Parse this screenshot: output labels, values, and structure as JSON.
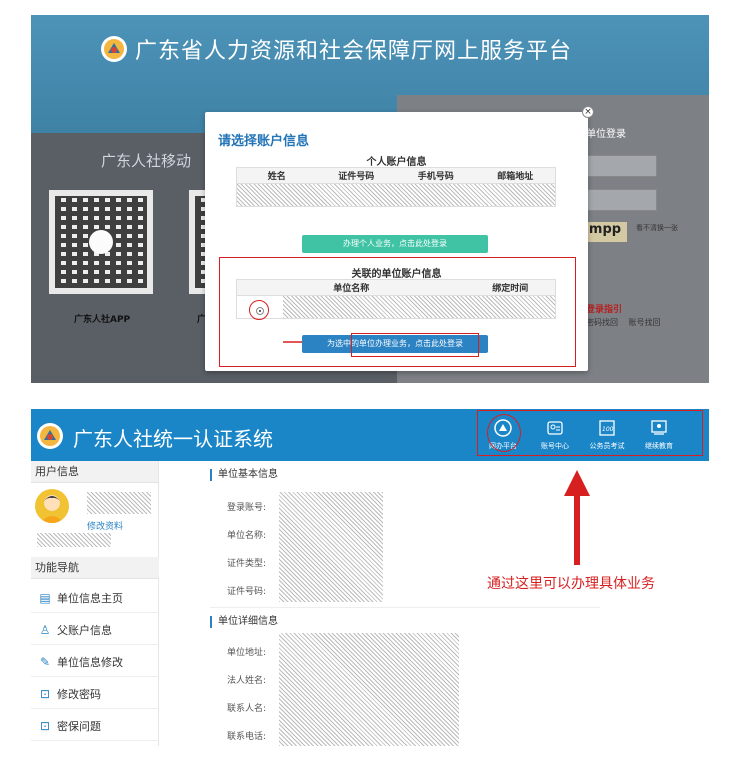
{
  "top": {
    "portal_title": "广东省人力资源和社会保障厅网上服务平台",
    "mobile_label": "广东人社移动",
    "qr1_caption": "广东人社APP",
    "qr2_caption": "广",
    "login_tab": "单位登录",
    "captcha_text": "mpp",
    "captcha_hint": "看不清换一张",
    "login_guide": "登录指引",
    "login_links": "密码找回 账号找回"
  },
  "modal": {
    "close_glyph": "×",
    "title": "请选择账户信息",
    "personal_section": "个人账户信息",
    "personal_columns": [
      "姓名",
      "证件号码",
      "手机号码",
      "邮箱地址"
    ],
    "personal_button": "办理个人业务，点击此处登录",
    "unit_section": "关联的单位账户信息",
    "unit_columns": [
      "单位名称",
      "绑定时间"
    ],
    "unit_button": "为选中的单位办理业务，点击此处登录"
  },
  "portal": {
    "title": "广东人社统一认证系统",
    "nav": [
      {
        "label": "网办平台",
        "icon": "emblem-icon"
      },
      {
        "label": "账号中心",
        "icon": "id-card-icon"
      },
      {
        "label": "公务员考试",
        "icon": "exam-icon"
      },
      {
        "label": "继续教育",
        "icon": "education-icon"
      }
    ]
  },
  "sidebar": {
    "user_info": "用户信息",
    "edit_profile": "修改资料",
    "nav_heading": "功能导航",
    "items": [
      {
        "label": "单位信息主页",
        "icon": "home-icon"
      },
      {
        "label": "父账户信息",
        "icon": "user-icon"
      },
      {
        "label": "单位信息修改",
        "icon": "edit-icon"
      },
      {
        "label": "修改密码",
        "icon": "lock-icon"
      },
      {
        "label": "密保问题",
        "icon": "lock-icon"
      }
    ]
  },
  "main": {
    "basic_heading": "单位基本信息",
    "basic_fields": [
      "登录账号:",
      "单位名称:",
      "证件类型:",
      "证件号码:"
    ],
    "detail_heading": "单位详细信息",
    "detail_fields": [
      "单位地址:",
      "法人姓名:",
      "联系人名:",
      "联系电话:"
    ]
  },
  "annotation": "通过这里可以办理具体业务",
  "colors": {
    "header_blue": "#1a86c8",
    "accent_blue": "#2c83c4",
    "modal_title": "#2375b8",
    "green_button": "#3fc3a4",
    "annotation_red": "#d81f1f"
  }
}
